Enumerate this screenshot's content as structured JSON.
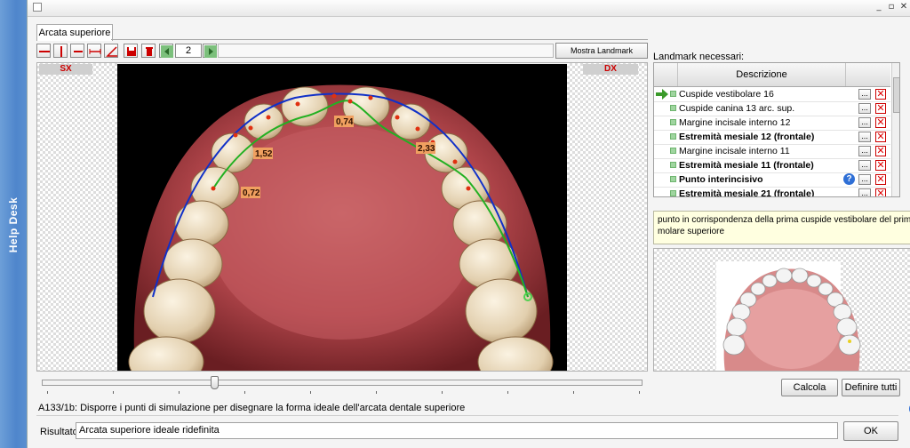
{
  "sidebar": {
    "label": "Help Desk"
  },
  "window": {
    "controls": [
      "_",
      "▫",
      "✕"
    ]
  },
  "tab": {
    "label": "Arcata superiore"
  },
  "toolbar": {
    "page_value": "2",
    "show_landmark_label": "Mostra Landmark corrente"
  },
  "image": {
    "left_label": "SX",
    "right_label": "DX",
    "measurements": [
      "0,74",
      "1,52",
      "2,33",
      "0,72"
    ]
  },
  "landmarks": {
    "title": "Landmark necessari:",
    "column_header": "Descrizione",
    "rows": [
      {
        "label": "Cuspide vestibolare 16",
        "bold": false,
        "current": true,
        "help": false
      },
      {
        "label": "Cuspide canina 13 arc. sup.",
        "bold": false,
        "current": false,
        "help": false
      },
      {
        "label": "Margine incisale interno 12",
        "bold": false,
        "current": false,
        "help": false
      },
      {
        "label": "Estremità mesiale 12 (frontale)",
        "bold": true,
        "current": false,
        "help": false
      },
      {
        "label": "Margine incisale interno 11",
        "bold": false,
        "current": false,
        "help": false
      },
      {
        "label": "Estremità mesiale 11 (frontale)",
        "bold": true,
        "current": false,
        "help": false
      },
      {
        "label": "Punto interincisivo",
        "bold": true,
        "current": false,
        "help": true
      },
      {
        "label": "Estremità mesiale 21 (frontale)",
        "bold": true,
        "current": false,
        "help": false
      }
    ],
    "dots_label": "...",
    "description": "punto in corrispondenza della prima cuspide vestibolare del primo molare superiore"
  },
  "buttons": {
    "calcola": "Calcola",
    "definire": "Definire tutti",
    "ok": "OK"
  },
  "status": {
    "text": "A133/1b: Disporre i punti di simulazione per disegnare la forma ideale dell'arcata dentale superiore"
  },
  "result": {
    "label": "Risultato:",
    "value": "Arcata superiore ideale ridefinita"
  },
  "colors": {
    "arch_ideal": "#1030c8",
    "arch_current": "#22b022",
    "point": "#e03010",
    "sidebar": "#4f86cc"
  }
}
